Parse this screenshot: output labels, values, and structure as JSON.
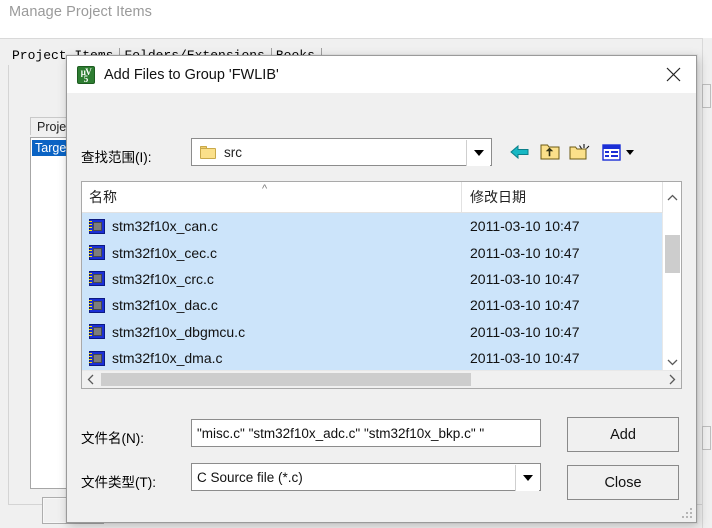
{
  "host": {
    "title": "Manage Project Items",
    "tabs": [
      {
        "label": "Project Items"
      },
      {
        "label": "Folders/Extensions"
      },
      {
        "label": "Books"
      }
    ],
    "group_label": "Projec",
    "selected_item": "Targe"
  },
  "dialog": {
    "title": "Add Files to Group 'FWLIB'",
    "app_icon": "uvision-icon",
    "icon_line1": "μV",
    "icon_line2": "5",
    "close_icon": "close-icon",
    "lookin": {
      "label": "查找范围(I):",
      "value": "src",
      "folder_icon": "folder-icon",
      "dropdown_icon": "chevron-down-icon"
    },
    "toolbar": [
      {
        "name": "back-icon",
        "title": "back"
      },
      {
        "name": "up-folder-icon",
        "title": "up one level"
      },
      {
        "name": "new-folder-icon",
        "title": "create new folder"
      },
      {
        "name": "views-icon",
        "title": "views"
      }
    ],
    "filelist": {
      "columns": [
        {
          "label": "名称",
          "sort": "asc",
          "sort_icon": "sort-ascending-icon"
        },
        {
          "label": "修改日期",
          "sort": ""
        }
      ],
      "rows": [
        {
          "icon": "c-source-file-icon",
          "name": "stm32f10x_can.c",
          "date": "2011-03-10 10:47",
          "selected": true
        },
        {
          "icon": "c-source-file-icon",
          "name": "stm32f10x_cec.c",
          "date": "2011-03-10 10:47",
          "selected": true
        },
        {
          "icon": "c-source-file-icon",
          "name": "stm32f10x_crc.c",
          "date": "2011-03-10 10:47",
          "selected": true
        },
        {
          "icon": "c-source-file-icon",
          "name": "stm32f10x_dac.c",
          "date": "2011-03-10 10:47",
          "selected": true
        },
        {
          "icon": "c-source-file-icon",
          "name": "stm32f10x_dbgmcu.c",
          "date": "2011-03-10 10:47",
          "selected": true
        },
        {
          "icon": "c-source-file-icon",
          "name": "stm32f10x_dma.c",
          "date": "2011-03-10 10:47",
          "selected": true
        }
      ],
      "vscroll": {
        "up_icon": "chevron-up-icon",
        "down_icon": "chevron-down-icon"
      },
      "hscroll": {
        "left_icon": "chevron-left-icon",
        "right_icon": "chevron-right-icon"
      }
    },
    "filename": {
      "label": "文件名(N):",
      "value": "\"misc.c\" \"stm32f10x_adc.c\" \"stm32f10x_bkp.c\" \""
    },
    "filetype": {
      "label": "文件类型(T):",
      "value": "C Source file (*.c)",
      "dropdown_icon": "chevron-down-icon"
    },
    "buttons": {
      "add": "Add",
      "close": "Close"
    },
    "resize_grip": "resize-grip-icon"
  },
  "colors": {
    "selection": "#cce4fa",
    "host_selection": "#0a63c4",
    "dialog_bg": "#f0f0f0",
    "titlebar_bg": "#ffffff",
    "icon_yellow": "#fbe08a",
    "icon_blue": "#1b2fd6",
    "accent_green": "#2e7d32"
  }
}
